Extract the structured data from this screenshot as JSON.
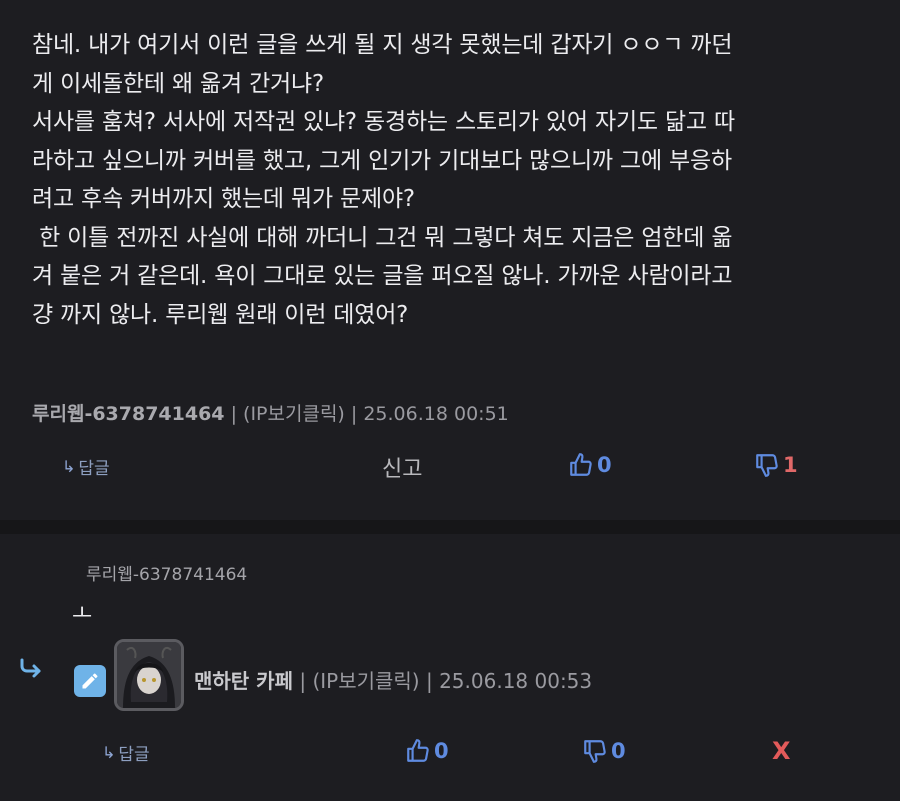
{
  "comment": {
    "lines": [
      "참네. 내가 여기서 이런 글을 쓰게 될 지 생각 못했는데 갑자기 ㅇㅇㄱ 까던",
      "게 이세돌한테 왜 옮겨 간거냐?",
      "서사를 훔쳐? 서사에 저작권 있냐? 동경하는 스토리가 있어 자기도 닮고 따",
      "라하고 싶으니까 커버를 했고, 그게 인기가 기대보다 많으니까 그에 부응하",
      "려고 후속 커버까지 했는데 뭐가 문제야?",
      " 한 이틀 전까진 사실에 대해 까더니 그건 뭐 그렇다 쳐도 지금은 엄한데 옮",
      "겨 붙은 거 같은데. 욕이 그대로 있는 글을 퍼오질 않나. 가까운 사람이라고",
      "걍 까지 않나. 루리웹 원래 이런 데였어?"
    ],
    "author": "루리웹-6378741464",
    "ip_label": "(IP보기클릭)",
    "timestamp": "25.06.18 00:51",
    "separator": "|",
    "reply_label": "답글",
    "report_label": "신고",
    "upvotes": "0",
    "downvotes": "1"
  },
  "reply": {
    "quoted_author": "루리웹-6378741464",
    "text": "ㅗ",
    "author": "맨하탄 카페",
    "ip_label": "(IP보기클릭)",
    "timestamp": "25.06.18 00:53",
    "separator": "|",
    "reply_label": "답글",
    "upvotes": "0",
    "downvotes": "0",
    "delete_label": "X"
  },
  "icons": {
    "reply_arrow": "reply-arrow-icon",
    "thumbs_up": "thumbs-up-icon",
    "thumbs_down": "thumbs-down-icon",
    "edit": "pencil-icon",
    "reply_indicator": "reply-indicator-icon"
  },
  "colors": {
    "background": "#1d1d21",
    "accent_blue": "#5f8be0",
    "accent_red": "#e06868",
    "edit_badge": "#6fb3e8"
  }
}
